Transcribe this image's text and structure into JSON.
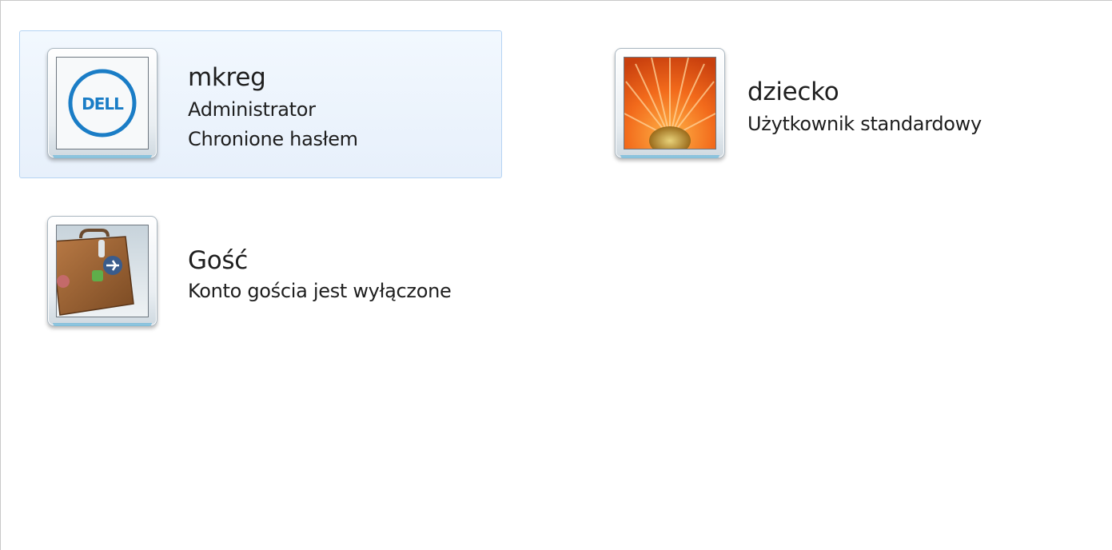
{
  "accounts": [
    {
      "name": "mkreg",
      "details": [
        "Administrator",
        "Chronione hasłem"
      ],
      "picture": "dell-logo-icon",
      "selected": true
    },
    {
      "name": "dziecko",
      "details": [
        "Użytkownik standardowy"
      ],
      "picture": "flower-icon",
      "selected": false
    },
    {
      "name": "Gość",
      "details": [
        "Konto gościa jest wyłączone"
      ],
      "picture": "suitcase-icon",
      "selected": false
    }
  ],
  "colors": {
    "selection_background": "#eaf2fc",
    "selection_border": "#b5d3f3",
    "dell_blue": "#1a7dc6",
    "flower_orange": "#f26a1b"
  },
  "logo_text": "DELL"
}
